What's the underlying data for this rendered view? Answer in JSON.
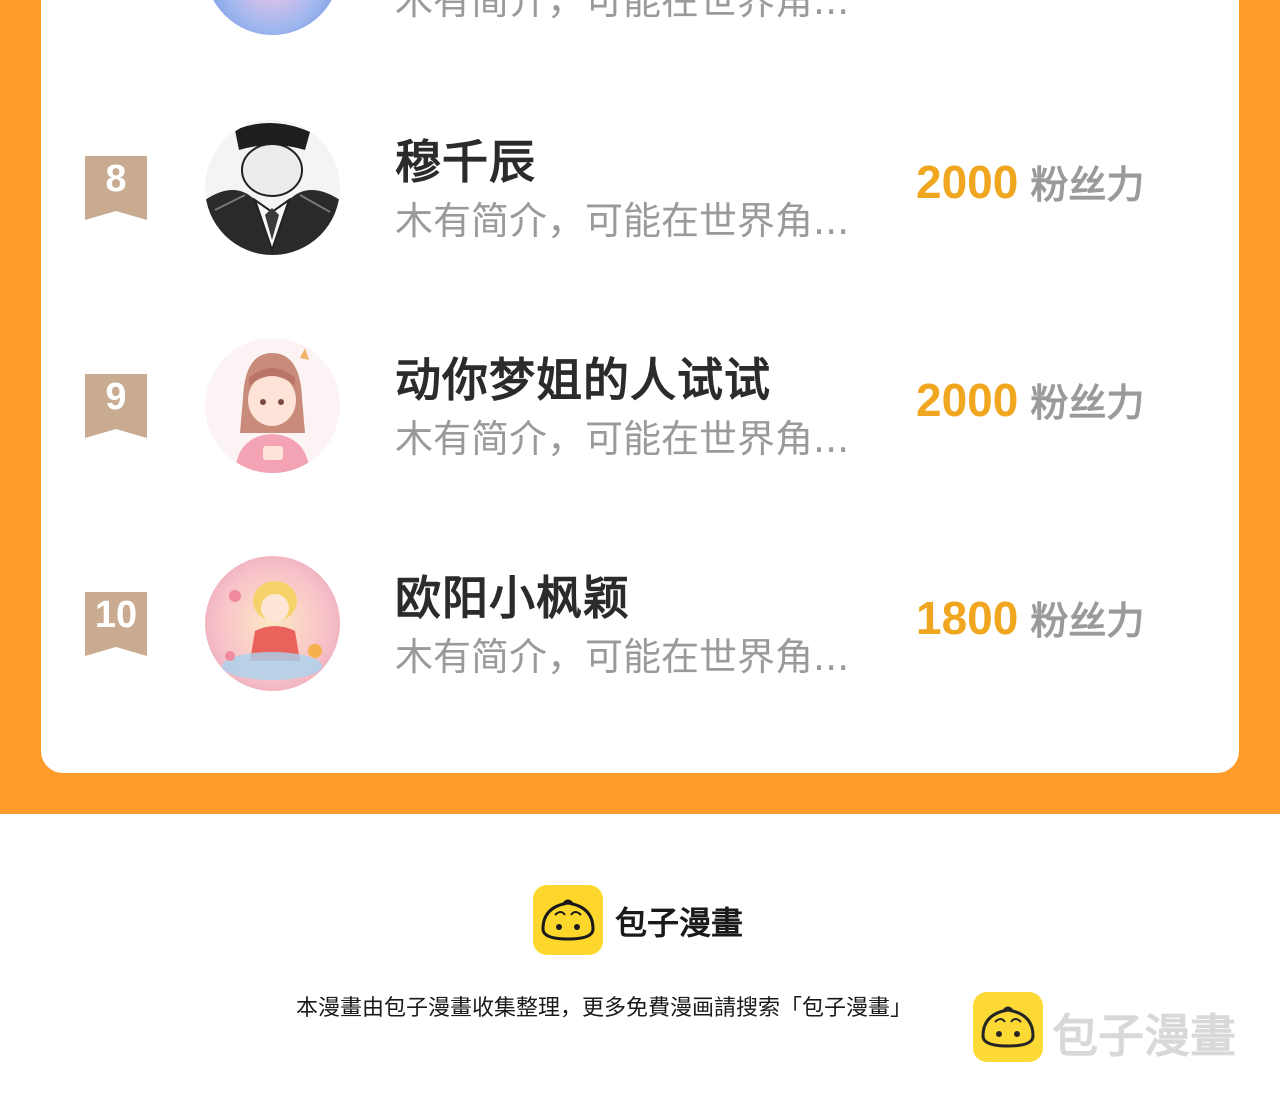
{
  "ranking": {
    "partial_item": {
      "description": "木有简介，可能在世界角..."
    },
    "items": [
      {
        "rank": "8",
        "name": "穆千辰",
        "description": "木有简介，可能在世界角...",
        "fans_count": "2000",
        "fans_unit": "粉丝力"
      },
      {
        "rank": "9",
        "name": "动你梦姐的人试试",
        "description": "木有简介，可能在世界角...",
        "fans_count": "2000",
        "fans_unit": "粉丝力"
      },
      {
        "rank": "10",
        "name": "欧阳小枫颖",
        "description": "木有简介，可能在世界角...",
        "fans_count": "1800",
        "fans_unit": "粉丝力"
      }
    ]
  },
  "footer": {
    "brand": "包子漫畫",
    "note": "本漫畫由包子漫畫收集整理，更多免費漫画請搜索「包子漫畫」"
  },
  "watermark": {
    "text": "包子漫畫"
  },
  "colors": {
    "frame": "#fd9c2b",
    "fans_count": "#f1a61f",
    "rank_badge": "#c9ab91",
    "logo": "#fdd72b"
  },
  "icons": {
    "rank_badge": "ribbon-bookmark",
    "logo": "steamed-bun-face-icon"
  }
}
